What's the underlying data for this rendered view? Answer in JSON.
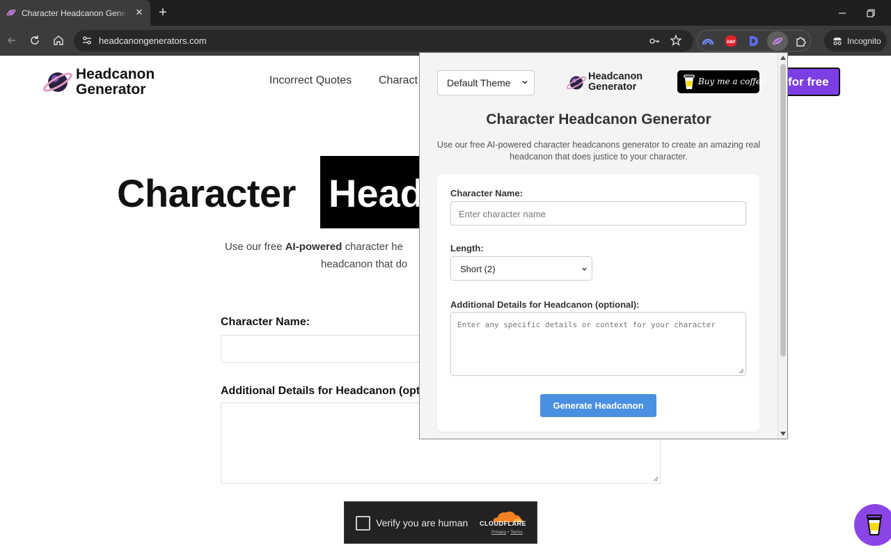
{
  "browser": {
    "tab_title": "Character Headcanon Generator",
    "new_tab_icon": "+",
    "tab_close_icon": "✕",
    "url": "headcanongenerators.com",
    "incognito_label": "Incognito"
  },
  "site": {
    "logo_line1": "Headcanon",
    "logo_line2": "Generator",
    "nav": [
      "Incorrect Quotes",
      "Charact"
    ],
    "cta_label": "for free",
    "hero_title": "Character",
    "hero_highlight": "Head",
    "subtitle_prefix": "Use our free ",
    "subtitle_bold": "AI-powered",
    "subtitle_rest": " character he",
    "subtitle_line2": "headcanon that do",
    "form": {
      "name_label": "Character Name:",
      "details_label": "Additional Details for Headcanon (opti"
    },
    "captcha": {
      "label": "Verify you are human",
      "brand": "CLOUDFLARE",
      "privacy": "Privacy",
      "separator": " • ",
      "terms": "Terms"
    }
  },
  "popup": {
    "theme_selected": "Default Theme",
    "logo_line1": "Headcanon",
    "logo_line2": "Generator",
    "bmc_label": "Buy me a coffee",
    "title": "Character Headcanon Generator",
    "description": "Use our free AI-powered character headcanons generator to create an amazing real headcanon that does justice to your character.",
    "form": {
      "name_label": "Character Name:",
      "name_placeholder": "Enter character name",
      "length_label": "Length:",
      "length_selected": "Short (2)",
      "details_label": "Additional Details for Headcanon (optional):",
      "details_placeholder": "Enter any specific details or context for your character",
      "generate_label": "Generate Headcanon"
    }
  },
  "colors": {
    "cta_purple": "#7b3fe4",
    "generate_blue": "#4a90e2",
    "chrome_dark": "#3c3c3c"
  }
}
